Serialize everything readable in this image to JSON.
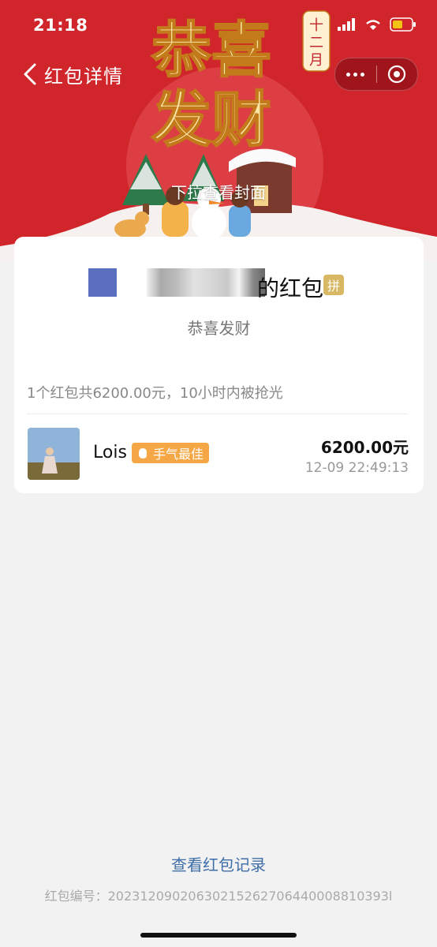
{
  "status_bar": {
    "time": "21:18",
    "battery_color": "#f3c316"
  },
  "nav": {
    "title": "红包详情"
  },
  "cover": {
    "banner_line1": "恭喜",
    "banner_line2": "发财",
    "month_tag": "十二月",
    "pull_hint": "下拉查看封面",
    "theme_color": "#d0252b"
  },
  "envelope": {
    "sender_suffix": "的红包",
    "pin_badge": "拼",
    "wish": "恭喜发财",
    "summary": "1个红包共6200.00元，10小时内被抢光"
  },
  "records": [
    {
      "name": "Lois",
      "badge": "手气最佳",
      "amount": "6200.00元",
      "time": "12-09 22:49:13"
    }
  ],
  "footer": {
    "records_link": "查看红包记录",
    "serial": "红包编号：20231209020630215262706440008810393l"
  }
}
